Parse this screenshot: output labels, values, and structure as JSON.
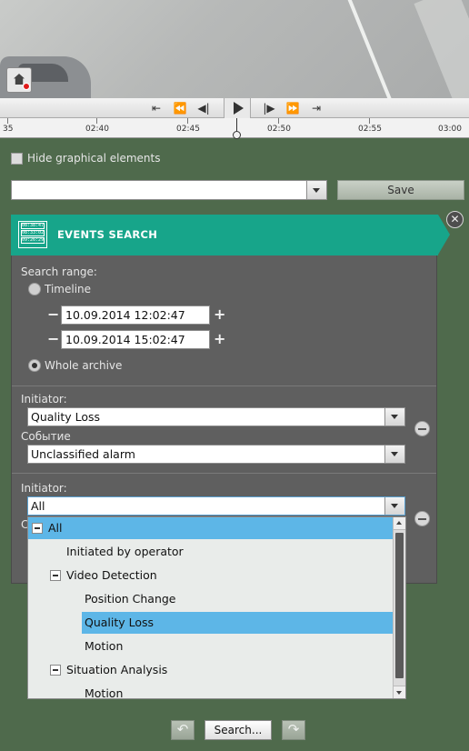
{
  "player": {
    "controls": [
      "⇤",
      "⏪",
      "◀|",
      "▶",
      "|▶",
      "⏩",
      "⇥"
    ],
    "timeline_labels": [
      "35",
      "02:40",
      "02:45",
      "02:50",
      "02:55",
      "03:00"
    ]
  },
  "options": {
    "hide_graphical_label": "Hide graphical elements",
    "layout_value": "",
    "save_label": "Save"
  },
  "panel": {
    "title": "EVENTS SEARCH",
    "icon_lines": [
      "08:38:47",
      "08:33:02",
      "09:26:29"
    ],
    "close_glyph": "✕",
    "search_range_label": "Search range:",
    "timeline_label": "Timeline",
    "range_start": "10.09.2014 12:02:47",
    "range_end": "10.09.2014 15:02:47",
    "whole_archive_label": "Whole archive",
    "minus_glyph": "−",
    "plus_glyph": "+",
    "filter1": {
      "initiator_label": "Initiator:",
      "initiator_value": "Quality Loss",
      "event_label": "Событие",
      "event_value": "Unclassified alarm"
    },
    "filter2": {
      "initiator_label": "Initiator:",
      "initiator_value": "All",
      "event_label_partial": "С"
    }
  },
  "tree": {
    "items": [
      {
        "label": "All",
        "level": 0,
        "expandable": true,
        "selected": true
      },
      {
        "label": "Initiated by operator",
        "level": 1,
        "expandable": false,
        "selected": false
      },
      {
        "label": "Video Detection",
        "level": 1,
        "expandable": true,
        "selected": false
      },
      {
        "label": "Position Change",
        "level": 2,
        "expandable": false,
        "selected": false
      },
      {
        "label": "Quality Loss",
        "level": 2,
        "expandable": false,
        "selected": true
      },
      {
        "label": "Motion",
        "level": 2,
        "expandable": false,
        "selected": false
      },
      {
        "label": "Situation Analysis",
        "level": 1,
        "expandable": true,
        "selected": false
      },
      {
        "label": "Motion",
        "level": 2,
        "expandable": false,
        "selected": false
      }
    ]
  },
  "footer": {
    "back_glyph": "↶",
    "search_label": "Search...",
    "forward_glyph": "↷"
  },
  "colors": {
    "accent": "#17a58a",
    "selection": "#5db6e7",
    "background": "#4f6a4c",
    "panel": "#5f5f5f"
  }
}
